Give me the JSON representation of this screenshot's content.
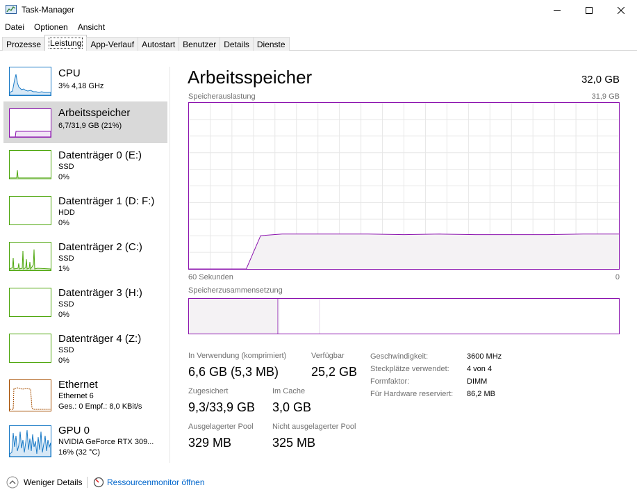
{
  "window": {
    "title": "Task-Manager"
  },
  "menu": [
    "Datei",
    "Optionen",
    "Ansicht"
  ],
  "tabs": [
    "Prozesse",
    "Leistung",
    "App-Verlauf",
    "Autostart",
    "Benutzer",
    "Details",
    "Dienste"
  ],
  "active_tab": "Leistung",
  "sidebar": [
    {
      "name": "CPU",
      "line1": "3% 4,18 GHz",
      "line2": ""
    },
    {
      "name": "Arbeitsspeicher",
      "line1": "6,7/31,9 GB (21%)",
      "line2": ""
    },
    {
      "name": "Datenträger 0 (E:)",
      "line1": "SSD",
      "line2": "0%"
    },
    {
      "name": "Datenträger 1 (D: F:)",
      "line1": "HDD",
      "line2": "0%"
    },
    {
      "name": "Datenträger 2 (C:)",
      "line1": "SSD",
      "line2": "1%"
    },
    {
      "name": "Datenträger 3 (H:)",
      "line1": "SSD",
      "line2": "0%"
    },
    {
      "name": "Datenträger 4 (Z:)",
      "line1": "SSD",
      "line2": "0%"
    },
    {
      "name": "Ethernet",
      "line1": "Ethernet 6",
      "line2": "Ges.: 0 Empf.: 8,0 KBit/s"
    },
    {
      "name": "GPU 0",
      "line1": "NVIDIA GeForce RTX 309...",
      "line2": "16% (32 °C)"
    }
  ],
  "main": {
    "title": "Arbeitsspeicher",
    "total": "32,0 GB",
    "usage_label": "Speicherauslastung",
    "usage_max": "31,9 GB",
    "time_left": "60 Sekunden",
    "time_right": "0",
    "composition_label": "Speicherzusammensetzung",
    "stats": {
      "in_use_label": "In Verwendung (komprimiert)",
      "in_use_value": "6,6 GB (5,3 MB)",
      "available_label": "Verfügbar",
      "available_value": "25,2 GB",
      "committed_label": "Zugesichert",
      "committed_value": "9,3/33,9 GB",
      "cached_label": "Im Cache",
      "cached_value": "3,0 GB",
      "paged_label": "Ausgelagerter Pool",
      "paged_value": "329 MB",
      "nonpaged_label": "Nicht ausgelagerter Pool",
      "nonpaged_value": "325 MB"
    },
    "details": [
      {
        "label": "Geschwindigkeit:",
        "value": "3600 MHz"
      },
      {
        "label": "Steckplätze verwendet:",
        "value": "4 von 4"
      },
      {
        "label": "Formfaktor:",
        "value": "DIMM"
      },
      {
        "label": "Für Hardware reserviert:",
        "value": "86,2 MB"
      }
    ]
  },
  "footer": {
    "fewer_details": "Weniger Details",
    "resource_monitor": "Ressourcenmonitor öffnen"
  },
  "chart_data": {
    "type": "area",
    "title": "Speicherauslastung",
    "xlabel": "60 Sekunden",
    "ylabel": "",
    "xlim": [
      60,
      0
    ],
    "ylim": [
      0,
      31.9
    ],
    "x": [
      60,
      52,
      50,
      47,
      45,
      40,
      35,
      30,
      25,
      20,
      15,
      10,
      5,
      0
    ],
    "series": [
      {
        "values": [
          0,
          0,
          6.4,
          6.7,
          6.7,
          6.7,
          6.7,
          6.6,
          6.7,
          6.6,
          6.6,
          6.6,
          6.7,
          6.7
        ]
      }
    ],
    "composition": {
      "in_use_gb": 6.6,
      "modified_gb": 0.1,
      "standby_gb": 3.0,
      "free_gb": 22.2
    },
    "colors": {
      "line": "#8b12ae",
      "fill": "#f4f2f4",
      "grid": "#e7e7e7"
    }
  }
}
